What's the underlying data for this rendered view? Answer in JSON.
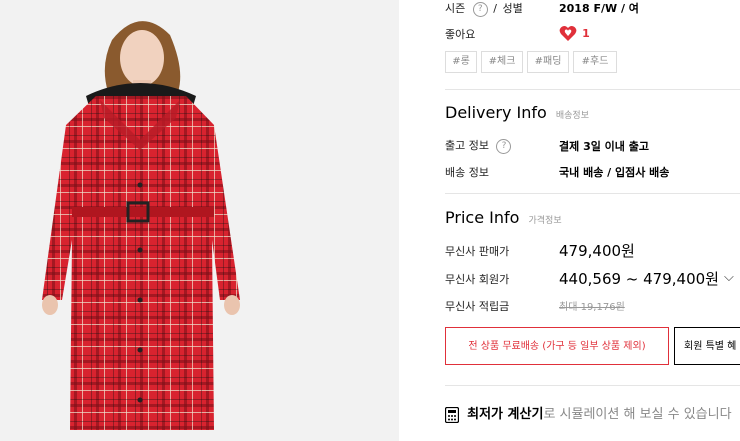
{
  "season": {
    "label": "시즌",
    "help": "?",
    "sep": "/",
    "gender_label": "성별",
    "value": "2018 F/W / 여"
  },
  "likes": {
    "label": "좋아요",
    "count": "1",
    "heart_color": "#e0303a"
  },
  "tags": [
    "#롱",
    "#체크",
    "#패딩",
    "#후드"
  ],
  "delivery": {
    "title": "Delivery Info",
    "subtitle": "배송정보",
    "ship_label": "출고 정보",
    "ship_value": "결제 3일 이내 출고",
    "method_label": "배송 정보",
    "method_value": "국내 배송 / 입점사 배송"
  },
  "price": {
    "title": "Price Info",
    "subtitle": "가격정보",
    "sale_label": "무신사 판매가",
    "sale_value": "479,400원",
    "member_label": "무신사 회원가",
    "member_value": "440,569 ~ 479,400원",
    "points_label": "무신사 적립금",
    "points_value": "최대 19,176원"
  },
  "buttons": {
    "free_shipping": "전 상품 무료배송 (가구 등 일부 상품 제외)",
    "member_special": "회원 특별 혜"
  },
  "calculator": {
    "bold": "최저가 계산기",
    "rest": "로 시뮬레이션 해 보실 수 있습니다"
  },
  "colors": {
    "accent": "#e0303a",
    "plaid_red": "#d8232f"
  },
  "product_image": {
    "icon": "model-wearing-red-plaid-long-padded-coat"
  }
}
